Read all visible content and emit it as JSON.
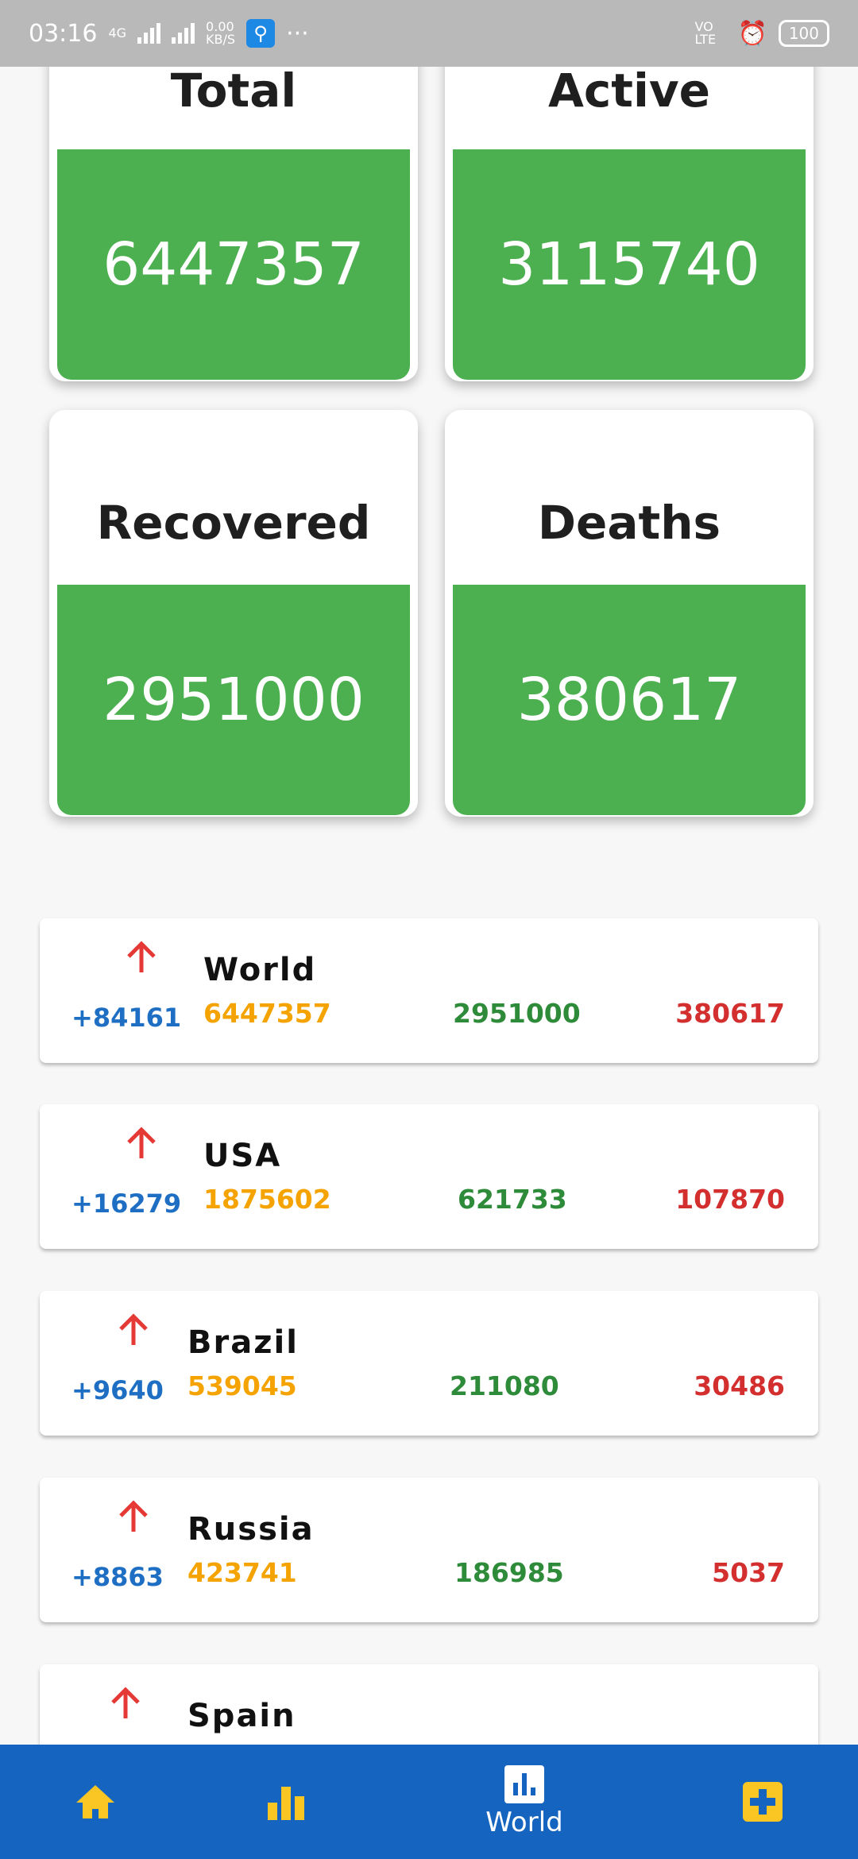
{
  "status_bar": {
    "time": "03:16",
    "network": "4G",
    "speed_value": "0.00",
    "speed_unit": "KB/S",
    "dots": "···",
    "volte": "VO LTE",
    "battery": "100"
  },
  "stats": {
    "total": {
      "label": "Total",
      "value": "6447357"
    },
    "active": {
      "label": "Active",
      "value": "3115740"
    },
    "recovered": {
      "label": "Recovered",
      "value": "2951000"
    },
    "deaths": {
      "label": "Deaths",
      "value": "380617"
    }
  },
  "countries": [
    {
      "name": "World",
      "delta": "+84161",
      "cases": "6447357",
      "recovered": "2951000",
      "deaths": "380617"
    },
    {
      "name": "USA",
      "delta": "+16279",
      "cases": "1875602",
      "recovered": "621733",
      "deaths": "107870"
    },
    {
      "name": "Brazil",
      "delta": "+9640",
      "cases": "539045",
      "recovered": "211080",
      "deaths": "30486"
    },
    {
      "name": "Russia",
      "delta": "+8863",
      "cases": "423741",
      "recovered": "186985",
      "deaths": "5037"
    },
    {
      "name": "Spain"
    }
  ],
  "bottom_nav": {
    "items": [
      {
        "icon": "home-icon"
      },
      {
        "icon": "bar-chart-icon"
      },
      {
        "icon": "world-chart-icon",
        "label": "World"
      },
      {
        "icon": "plus-icon"
      }
    ]
  },
  "colors": {
    "accent_green": "#4caf50",
    "nav_blue": "#1565c0",
    "nav_icon_yellow": "#f9c623",
    "cases_orange": "#f5a300",
    "recovered_green": "#2e8b3a",
    "deaths_red": "#d32f2f",
    "delta_blue": "#1e6fc4"
  }
}
